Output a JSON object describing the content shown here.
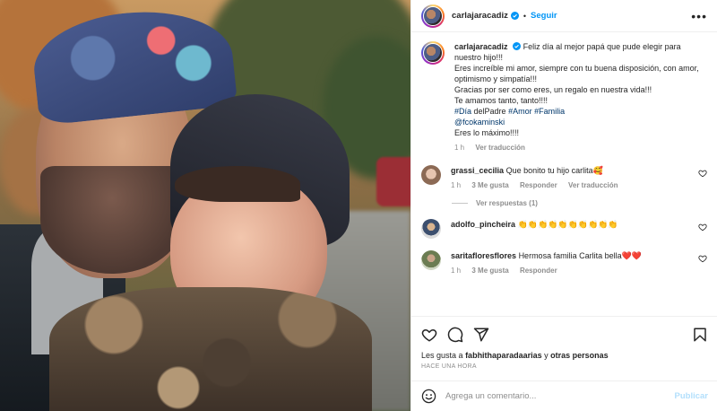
{
  "post": {
    "author": "carlajaracadiz",
    "follow_label": "Seguir",
    "separator": "•"
  },
  "caption": {
    "line1": "Feliz día al mejor papá que pude elegir para nuestro hijo!!!",
    "line2": "Eres increíble mi amor, siempre con tu buena disposición, con amor, optimismo y simpatía!!!",
    "line3": "Gracias por ser como eres, un regalo en nuestra vida!!!",
    "line4": "Te amamos tanto, tanto!!!!",
    "tag_dia": "#Día",
    "del_padre": "delPadre",
    "tag_amor": "#Amor",
    "tag_familia": "#Familia",
    "mention": "@fcokaminski",
    "line6": "Eres lo máximo!!!!",
    "time": "1 h",
    "translate": "Ver traducción"
  },
  "comments": [
    {
      "user": "grassi_cecilia",
      "text": "Que bonito tu hijo carlita🥰",
      "time": "1 h",
      "likes": "3 Me gusta",
      "reply": "Responder",
      "translate": "Ver traducción",
      "replies": "Ver respuestas (1)"
    },
    {
      "user": "adolfo_pincheira",
      "text": "👏👏👏👏👏👏👏👏👏👏",
      "time": "",
      "likes": "",
      "reply": "",
      "translate": ""
    },
    {
      "user": "saritafloresflores",
      "text": "Hermosa familia Carlita bella❤️❤️",
      "time": "1 h",
      "likes": "3 Me gusta",
      "reply": "Responder",
      "translate": ""
    }
  ],
  "likes": {
    "prefix": "Les gusta a",
    "user": "fabhithaparadaarias",
    "connector": "y",
    "others": "otras personas"
  },
  "posted": "HACE UNA HORA",
  "add_comment": {
    "placeholder": "Agrega un comentario...",
    "publish": "Publicar"
  },
  "colors": {
    "accent": "#0095f6",
    "publish_disabled": "#b2dffc",
    "hashtag": "#00376b",
    "muted": "#8e8e8e"
  }
}
